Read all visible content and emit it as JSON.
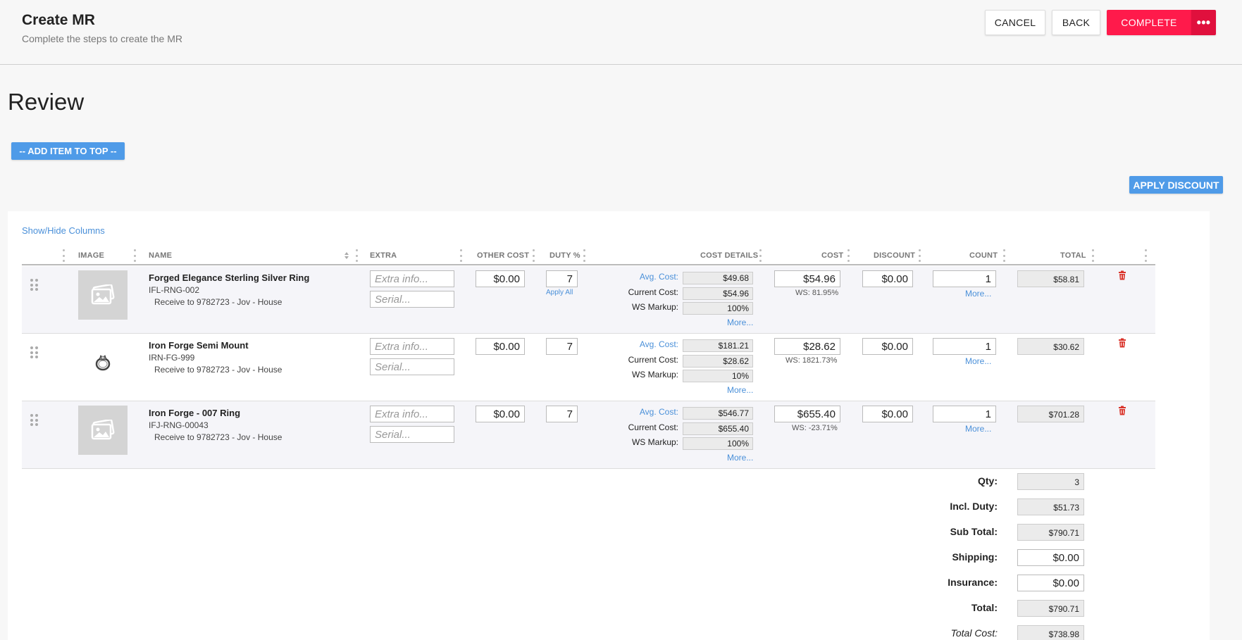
{
  "header": {
    "title": "Create MR",
    "subtitle": "Complete the steps to create the MR",
    "cancel_label": "CANCEL",
    "back_label": "BACK",
    "complete_label": "COMPLETE",
    "more_label": "•••"
  },
  "page": {
    "title": "Review",
    "add_item_label": "-- ADD ITEM TO TOP --",
    "apply_discount_label": "APPLY DISCOUNT",
    "show_hide_label": "Show/Hide Columns"
  },
  "columns": {
    "image": "IMAGE",
    "name": "NAME",
    "extra": "EXTRA",
    "other_cost": "OTHER COST",
    "duty": "DUTY %",
    "cost_details": "COST DETAILS",
    "cost": "COST",
    "discount": "DISCOUNT",
    "count": "COUNT",
    "total": "TOTAL"
  },
  "labels": {
    "extra_placeholder": "Extra info...",
    "serial_placeholder": "Serial...",
    "apply_all": "Apply All",
    "avg_cost": "Avg. Cost:",
    "current_cost": "Current Cost:",
    "ws_markup": "WS Markup:",
    "more": "More..."
  },
  "items": [
    {
      "name": "Forged Elegance Sterling Silver Ring",
      "sku": "IFL-RNG-002",
      "receive": "Receive to 9782723 - Jov - House",
      "image": "placeholder-image-icon",
      "other_cost": "$0.00",
      "duty": "7",
      "avg_cost": "$49.68",
      "current_cost": "$54.96",
      "ws_markup": "100%",
      "cost": "$54.96",
      "ws": "WS: 81.95%",
      "discount": "$0.00",
      "count": "1",
      "total": "$58.81"
    },
    {
      "name": "Iron Forge Semi Mount",
      "sku": "IRN-FG-999",
      "receive": "Receive to 9782723 - Jov - House",
      "image": "ring-photo",
      "other_cost": "$0.00",
      "duty": "7",
      "avg_cost": "$181.21",
      "current_cost": "$28.62",
      "ws_markup": "10%",
      "cost": "$28.62",
      "ws": "WS: 1821.73%",
      "discount": "$0.00",
      "count": "1",
      "total": "$30.62"
    },
    {
      "name": "Iron Forge - 007 Ring",
      "sku": "IFJ-RNG-00043",
      "receive": "Receive to 9782723 - Jov - House",
      "image": "placeholder-image-icon",
      "other_cost": "$0.00",
      "duty": "7",
      "avg_cost": "$546.77",
      "current_cost": "$655.40",
      "ws_markup": "100%",
      "cost": "$655.40",
      "ws": "WS: -23.71%",
      "discount": "$0.00",
      "count": "1",
      "total": "$701.28"
    }
  ],
  "summary": {
    "qty_label": "Qty:",
    "qty": "3",
    "duty_label": "Incl. Duty:",
    "duty": "$51.73",
    "subtotal_label": "Sub Total:",
    "subtotal": "$790.71",
    "shipping_label": "Shipping:",
    "shipping": "$0.00",
    "insurance_label": "Insurance:",
    "insurance": "$0.00",
    "total_label": "Total:",
    "total": "$790.71",
    "total_cost_label": "Total Cost:",
    "total_cost": "$738.98"
  },
  "colors": {
    "accent_red": "#ff1a4b",
    "accent_blue": "#4f9be8",
    "link_blue": "#4a90d9",
    "trash_red": "#d9342b"
  }
}
